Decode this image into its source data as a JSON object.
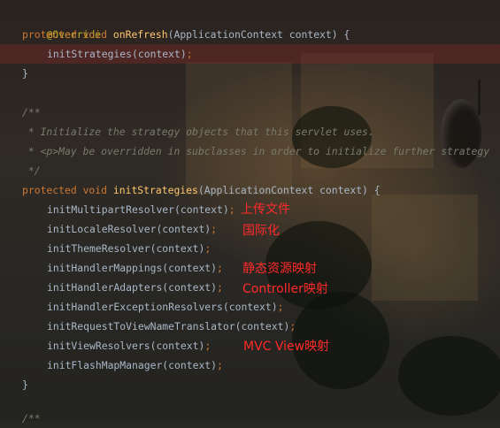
{
  "colors": {
    "keyword": "#cc7832",
    "method": "#ffc66d",
    "annotation": "#bbb529",
    "comment": "#7a7a6a",
    "plain": "#a9b7c6",
    "note": "#ff2a2a"
  },
  "code": {
    "override": "@Override",
    "on_refresh": {
      "modifiers": "protected void",
      "name": "onRefresh",
      "params": "(ApplicationContext context) {"
    },
    "on_refresh_body": {
      "call": "initStrategies(context)",
      "semicolon": ";"
    },
    "close_brace_1": "}",
    "javadoc": {
      "open": "/**",
      "line1": " * Initialize the strategy objects that this servlet uses.",
      "line2": " * <p>May be overridden in subclasses in order to initialize further strategy",
      "close": " */"
    },
    "init_strategies": {
      "modifiers": "protected void",
      "name": "initStrategies",
      "params": "(ApplicationContext context) {"
    },
    "calls": [
      "initMultipartResolver(context)",
      "initLocaleResolver(context)",
      "initThemeResolver(context)",
      "initHandlerMappings(context)",
      "initHandlerAdapters(context)",
      "initHandlerExceptionResolvers(context)",
      "initRequestToViewNameTranslator(context)",
      "initViewResolvers(context)",
      "initFlashMapManager(context)"
    ],
    "semicolon": ";",
    "close_brace_2": "}",
    "trailing": "/**"
  },
  "annotations": {
    "multipart": "上传文件",
    "locale": "国际化",
    "handler_mappings": "静态资源映射",
    "handler_adapters": "Controller映射",
    "view_resolvers": "MVC View映射"
  }
}
